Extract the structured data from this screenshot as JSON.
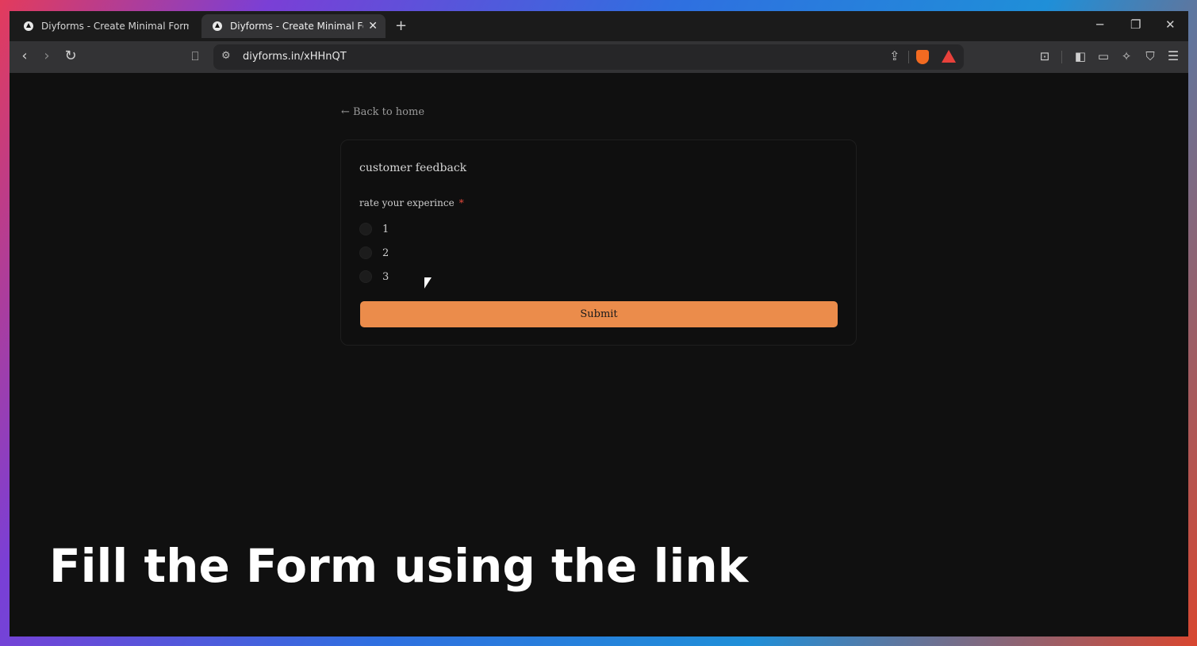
{
  "tabs": [
    {
      "title": "Diyforms - Create Minimal Forms",
      "active": false
    },
    {
      "title": "Diyforms - Create Minimal Forms",
      "active": true
    }
  ],
  "toolbar": {
    "url": "diyforms.in/xHHnQT"
  },
  "page": {
    "back_link": "← Back to home",
    "form_title": "customer feedback",
    "question": "rate your experince",
    "required_marker": "*",
    "options": [
      "1",
      "2",
      "3"
    ],
    "submit_label": "Submit"
  },
  "caption": "Fill the Form using the link",
  "colors": {
    "submit": "#eb8c4b",
    "required": "#e84a3c",
    "page_bg": "#101010"
  }
}
